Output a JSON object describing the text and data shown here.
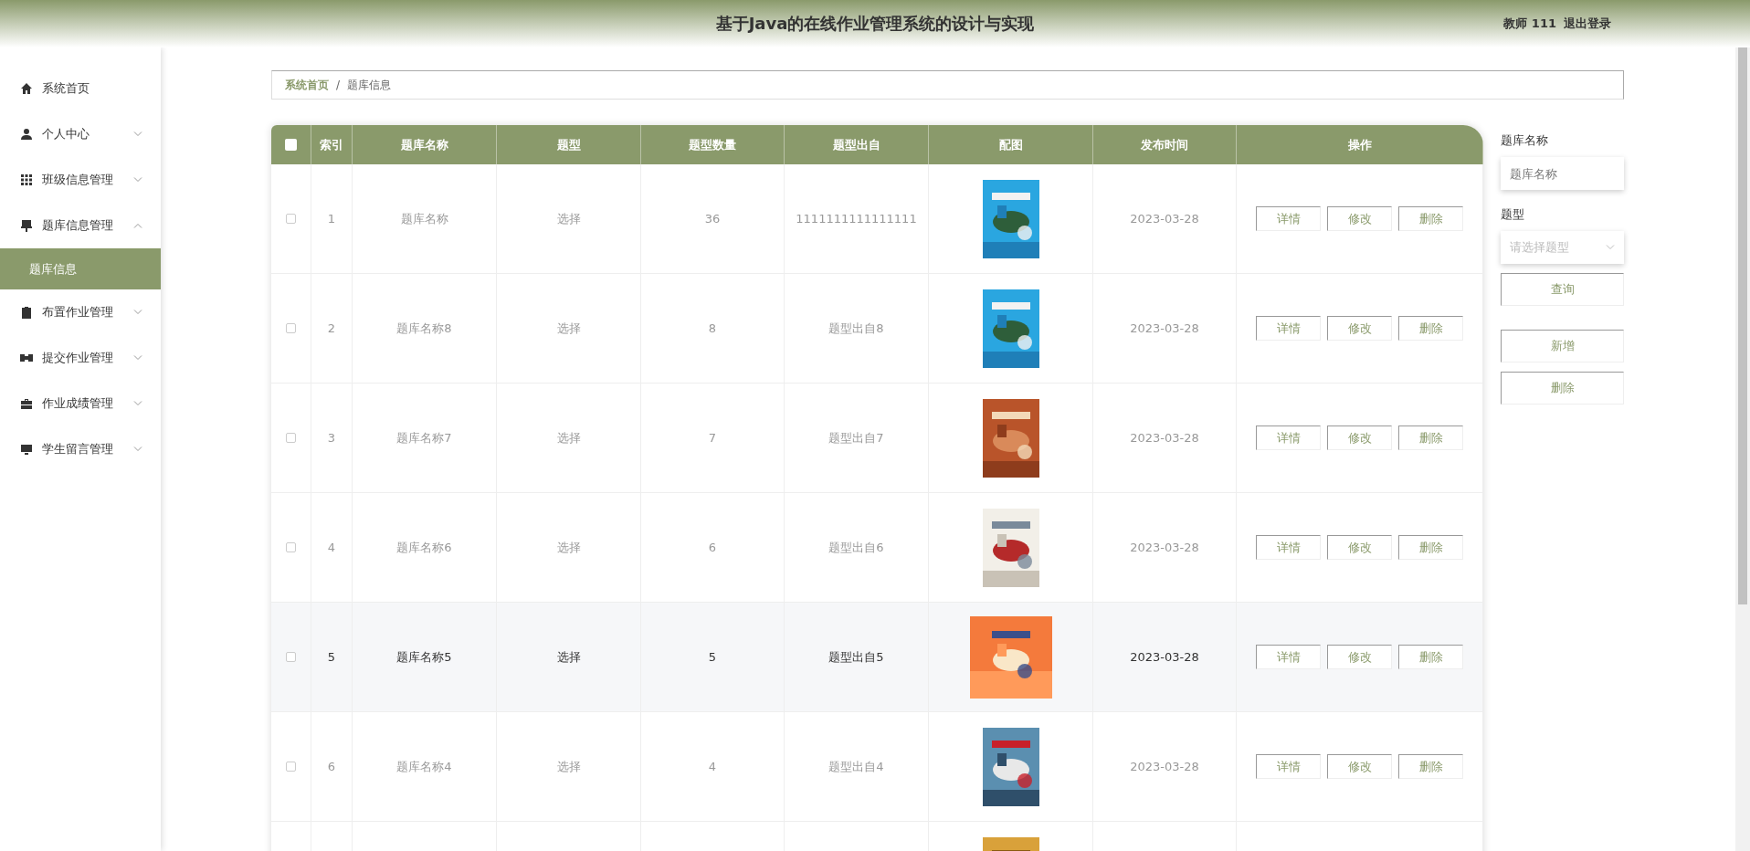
{
  "header": {
    "title": "基于Java的在线作业管理系统的设计与实现",
    "user_role": "教师",
    "user_name": "111",
    "logout": "退出登录"
  },
  "sidebar": {
    "items": [
      {
        "label": "系统首页",
        "kind": "link"
      },
      {
        "label": "个人中心",
        "kind": "menu",
        "expanded": false
      },
      {
        "label": "班级信息管理",
        "kind": "menu",
        "expanded": false
      },
      {
        "label": "题库信息管理",
        "kind": "menu",
        "expanded": true,
        "children": [
          {
            "label": "题库信息",
            "selected": true
          }
        ]
      },
      {
        "label": "布置作业管理",
        "kind": "menu",
        "expanded": false
      },
      {
        "label": "提交作业管理",
        "kind": "menu",
        "expanded": false
      },
      {
        "label": "作业成绩管理",
        "kind": "menu",
        "expanded": false
      },
      {
        "label": "学生留言管理",
        "kind": "menu",
        "expanded": false
      }
    ]
  },
  "breadcrumb": {
    "items": [
      "系统首页",
      "题库信息"
    ],
    "separator": "/"
  },
  "table": {
    "select_all": {
      "checked": false
    },
    "columns": [
      "索引",
      "题库名称",
      "题型",
      "题型数量",
      "题型出自",
      "配图",
      "发布时间",
      "操作"
    ],
    "rows": [
      {
        "checked": false,
        "hovered": false,
        "cells": [
          "1",
          "题库名称",
          "选择",
          "36",
          "1111111111111111"
        ],
        "cover": {
          "kind": "picture"
        },
        "date": "2023-03-28",
        "actions": [
          "详情",
          "修改",
          "删除"
        ]
      },
      {
        "checked": false,
        "hovered": false,
        "cells": [
          "2",
          "题库名称8",
          "选择",
          "8",
          "题型出自8"
        ],
        "cover": {
          "kind": "picture"
        },
        "date": "2023-03-28",
        "actions": [
          "详情",
          "修改",
          "删除"
        ]
      },
      {
        "checked": false,
        "hovered": false,
        "cells": [
          "3",
          "题库名称7",
          "选择",
          "7",
          "题型出自7"
        ],
        "cover": {
          "kind": "picture"
        },
        "date": "2023-03-28",
        "actions": [
          "详情",
          "修改",
          "删除"
        ]
      },
      {
        "checked": false,
        "hovered": false,
        "cells": [
          "4",
          "题库名称6",
          "选择",
          "6",
          "题型出自6"
        ],
        "cover": {
          "kind": "picture"
        },
        "date": "2023-03-28",
        "actions": [
          "详情",
          "修改",
          "删除"
        ]
      },
      {
        "checked": false,
        "hovered": true,
        "cells": [
          "5",
          "题库名称5",
          "选择",
          "5",
          "题型出自5"
        ],
        "cover": {
          "kind": "picture"
        },
        "date": "2023-03-28",
        "actions": [
          "详情",
          "修改",
          "删除"
        ]
      },
      {
        "checked": false,
        "hovered": false,
        "cells": [
          "6",
          "题库名称4",
          "选择",
          "4",
          "题型出自4"
        ],
        "cover": {
          "kind": "picture"
        },
        "date": "2023-03-28",
        "actions": [
          "详情",
          "修改",
          "删除"
        ]
      },
      {
        "cover": {
          "kind": "picture"
        }
      }
    ]
  },
  "search": {
    "name_label": "题库名称",
    "name_placeholder": "题库名称",
    "type_label": "题型",
    "type_placeholder": "请选择题型",
    "query_button": "查询",
    "add_button": "新增",
    "delete_button": "删除"
  }
}
